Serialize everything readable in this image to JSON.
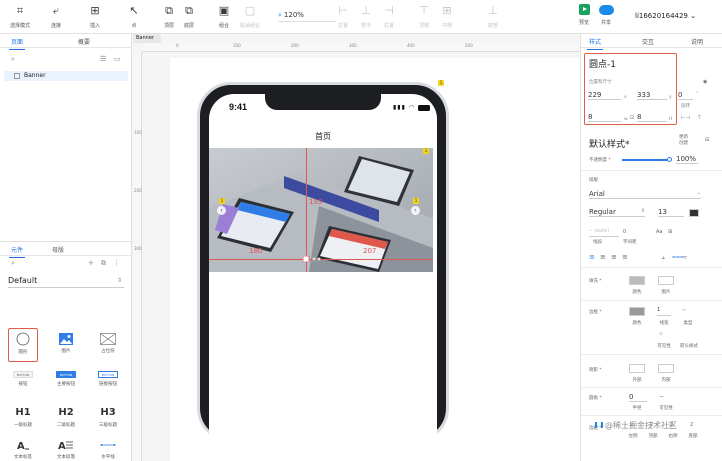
{
  "toolbar": {
    "items": [
      {
        "label": "选择模式",
        "icon": "select-mode-icon"
      },
      {
        "label": "连接",
        "icon": "connect-icon"
      },
      {
        "label": "插入",
        "icon": "insert-icon"
      },
      {
        "label": "点",
        "icon": "point-icon"
      },
      {
        "label": "顶层",
        "icon": "top-layer-icon"
      },
      {
        "label": "底层",
        "icon": "bottom-layer-icon"
      },
      {
        "label": "组合",
        "icon": "group-icon"
      },
      {
        "label": "取消组合",
        "icon": "ungroup-icon"
      },
      {
        "label": "左置",
        "icon": "align-left-icon"
      },
      {
        "label": "居中",
        "icon": "align-center-icon"
      },
      {
        "label": "右置",
        "icon": "align-right-icon"
      },
      {
        "label": "顶部",
        "icon": "align-top-icon"
      },
      {
        "label": "中部",
        "icon": "align-middle-icon"
      },
      {
        "label": "底部",
        "icon": "align-bottom-icon"
      },
      {
        "label": "预览",
        "icon": "preview-icon"
      },
      {
        "label": "共享",
        "icon": "share-icon"
      }
    ],
    "zoom": "120%",
    "user": "li16620164429"
  },
  "left_panel": {
    "tabs": [
      "页面",
      "概要"
    ],
    "pages": [
      "Banner"
    ],
    "library_tabs": [
      "元件",
      "母版"
    ],
    "library_select": "Default",
    "widgets": [
      {
        "label": "圆形",
        "icon": "circle-icon"
      },
      {
        "label": "图片",
        "icon": "image-icon"
      },
      {
        "label": "占位符",
        "icon": "placeholder-icon"
      },
      {
        "label": "按钮",
        "icon": "button-icon"
      },
      {
        "label": "主要按钮",
        "icon": "primary-button-icon"
      },
      {
        "label": "链接按钮",
        "icon": "link-button-icon"
      },
      {
        "label": "一级标题",
        "icon": "h1-icon"
      },
      {
        "label": "二级标题",
        "icon": "h2-icon"
      },
      {
        "label": "三级标题",
        "icon": "h3-icon"
      },
      {
        "label": "文本标签",
        "icon": "text-label-icon"
      },
      {
        "label": "文本段落",
        "icon": "text-paragraph-icon"
      },
      {
        "label": "水平线",
        "icon": "horizontal-line-icon"
      }
    ],
    "heading_glyphs": [
      "H1",
      "H2",
      "H3"
    ],
    "button_glyph": "BUTTON"
  },
  "canvas": {
    "tab": "Banner",
    "ruler_h": [
      "0",
      "100",
      "200",
      "300",
      "400",
      "500"
    ],
    "ruler_v": [
      "100",
      "200",
      "300"
    ],
    "phone": {
      "time": "9:41",
      "title": "首页"
    },
    "measurements": {
      "top": "193",
      "left": "180",
      "right": "207"
    }
  },
  "right_panel": {
    "tabs": [
      "样式",
      "交互",
      "说明"
    ],
    "element_name": "圆点-1",
    "position_label": "位置和尺寸",
    "x": "229",
    "x_label": "x",
    "y": "333",
    "y_label": "y",
    "rotation": "0",
    "rotation_unit": "°",
    "rotation_label": "旋转",
    "w": "8",
    "w_label": "w",
    "h": "8",
    "h_label": "H",
    "style_title": "默认样式*",
    "update_style": "更新\n创建",
    "opacity_label": "不透明度 *",
    "opacity_value": "100%",
    "font_label": "排版",
    "font": "Arial",
    "weight": "Regular",
    "size": "13",
    "line_height_placeholder": "-- (auto)",
    "line_label": "线段",
    "letter_label": "字间距",
    "fill_label": "填充 *",
    "fill_color": "颜色",
    "fill_image": "图片",
    "border_label": "边框 *",
    "border_color": "颜色",
    "border_width": "线宽",
    "border_type": "类型",
    "visible_label": "可见性",
    "arrow_label": "箭头样式",
    "shadow_label": "阴影 *",
    "shadow_outer": "外部",
    "shadow_inner": "内部",
    "radius_label": "圆角 *",
    "radius_value": "0",
    "radius_half": "半径",
    "radius_visible": "可见性",
    "padding_label": "边距 *",
    "padding_items": [
      "左侧",
      "顶部",
      "右侧",
      "底部"
    ]
  },
  "watermark": "@稀土掘金技术社区",
  "colors": {
    "accent": "#1a73e8",
    "highlight": "#e05c4b",
    "guide": "#e05555"
  }
}
